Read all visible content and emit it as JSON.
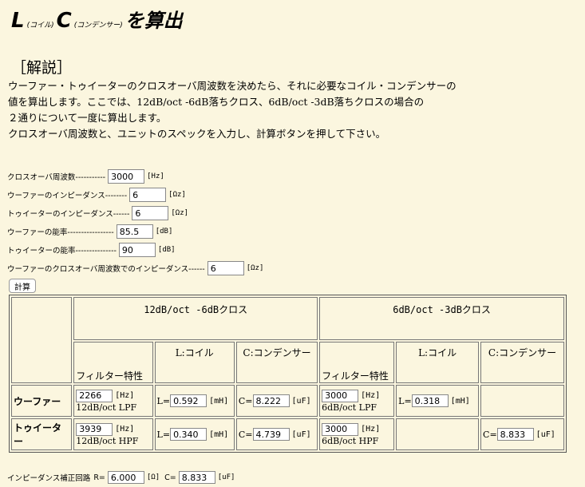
{
  "title": {
    "l": "L",
    "l_note": "(コイル)",
    "c": "C",
    "c_note": "(コンデンサー)",
    "suffix": "を算出"
  },
  "section_heading": "［解説］",
  "description": [
    "ウーファー・トゥイーターのクロスオーバ周波数を決めたら、それに必要なコイル・コンデンサーの",
    "値を算出します。ここでは、12dB/oct -6dB落ちクロス、6dB/oct -3dB落ちクロスの場合の",
    "２通りについて一度に算出します。",
    "クロスオーバ周波数と、ユニットのスペックを入力し、計算ボタンを押して下さい。"
  ],
  "inputs": [
    {
      "label": "クロスオーバ周波数-----------",
      "value": "3000",
      "unit": "[Hz]"
    },
    {
      "label": "ウーファーのインピーダンス--------",
      "value": "6",
      "unit": "[Ωz]"
    },
    {
      "label": "トゥイーターのインピーダンス------",
      "value": "6",
      "unit": "[Ωz]"
    },
    {
      "label": "ウーファーの能率-----------------",
      "value": "85.5",
      "unit": "[dB]"
    },
    {
      "label": "トゥイーターの能率---------------",
      "value": "90",
      "unit": "[dB]"
    },
    {
      "label": "ウーファーのクロスオーバ周波数でのインピーダンス------",
      "value": "6",
      "unit": "[Ωz]"
    }
  ],
  "calc_button": "計算",
  "table": {
    "group1": "12dB/oct -6dBクロス",
    "group2": "6dB/oct -3dBクロス",
    "sub_filter": "フィルター特性",
    "sub_l": "L:コイル",
    "sub_c": "C:コンデンサー",
    "woofer": {
      "label": "ウーファー",
      "g1_freq": "2266",
      "g1_freq_unit": "[Hz]",
      "g1_type": "12dB/oct LPF",
      "g1_l_prefix": "L=",
      "g1_l": "0.592",
      "g1_l_unit": "[mH]",
      "g1_c_prefix": "C=",
      "g1_c": "8.222",
      "g1_c_unit": "[uF]",
      "g2_freq": "3000",
      "g2_freq_unit": "[Hz]",
      "g2_type": "6dB/oct LPF",
      "g2_l_prefix": "L=",
      "g2_l": "0.318",
      "g2_l_unit": "[mH]"
    },
    "tweeter": {
      "label": "トゥイーター",
      "g1_freq": "3939",
      "g1_freq_unit": "[Hz]",
      "g1_type": "12dB/oct HPF",
      "g1_l_prefix": "L=",
      "g1_l": "0.340",
      "g1_l_unit": "[mH]",
      "g1_c_prefix": "C=",
      "g1_c": "4.739",
      "g1_c_unit": "[uF]",
      "g2_freq": "3000",
      "g2_freq_unit": "[Hz]",
      "g2_type": "6dB/oct HPF",
      "g2_c_prefix": "C=",
      "g2_c": "8.833",
      "g2_c_unit": "[uF]"
    }
  },
  "impedance": {
    "label": "インピーダンス補正回路",
    "r_prefix": "R=",
    "r": "6.000",
    "r_unit": "[Ω]",
    "c_prefix": "C=",
    "c": "8.833",
    "c_unit": "[uF]"
  }
}
